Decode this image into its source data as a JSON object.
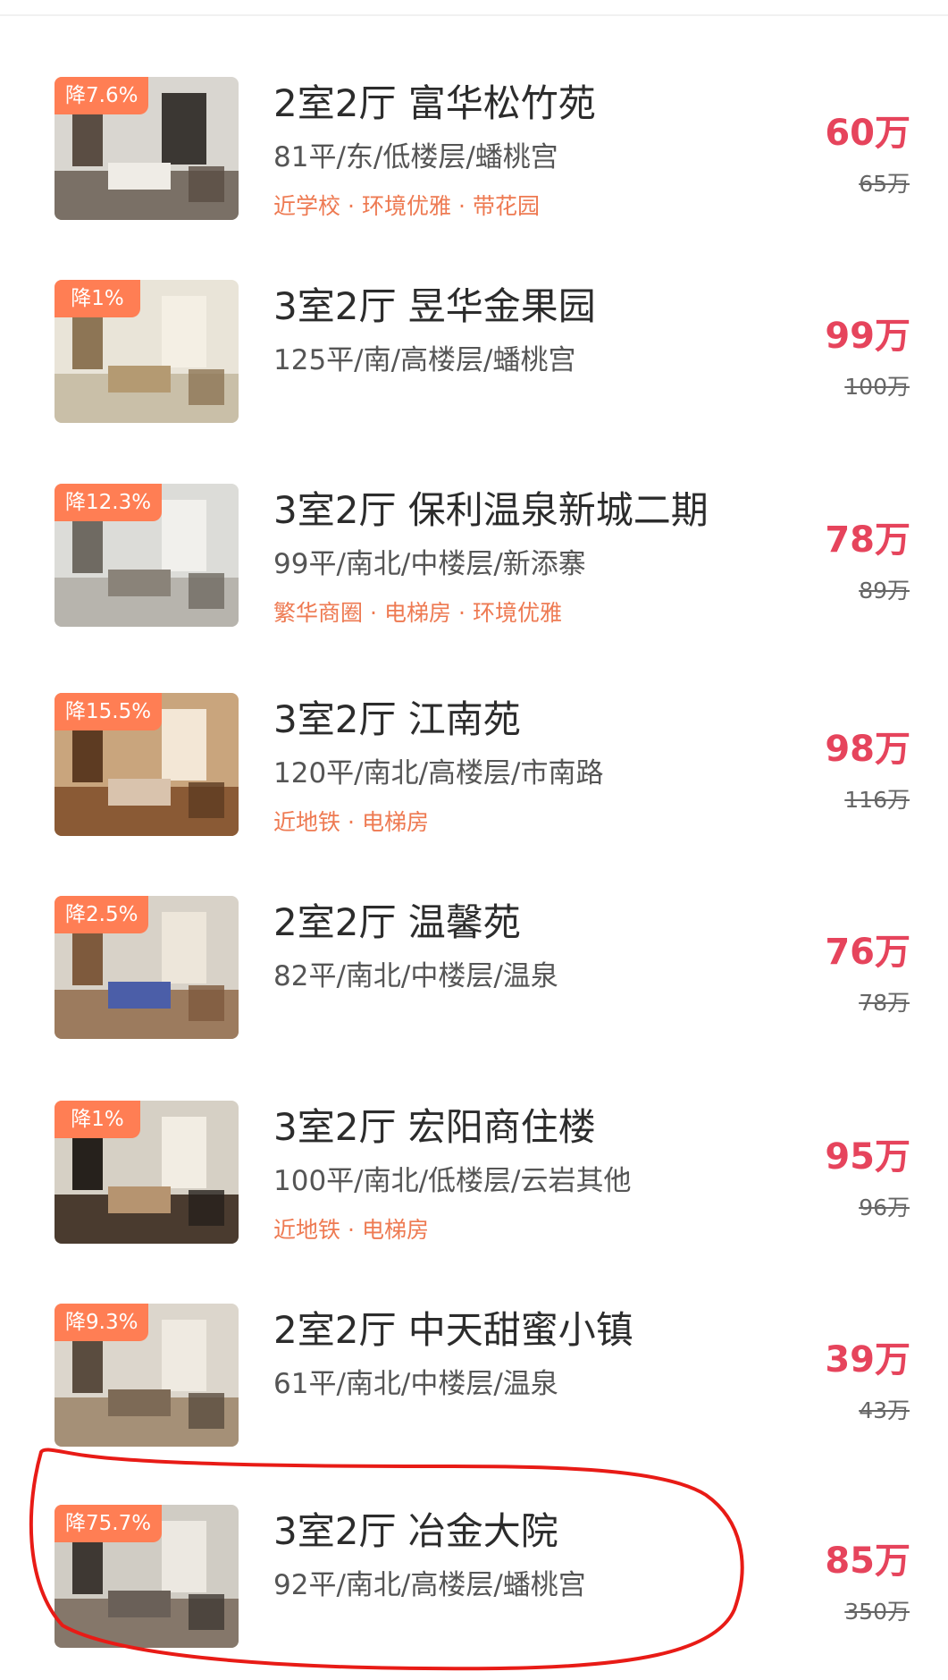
{
  "colors": {
    "badge_bg": "#ff7e54",
    "price": "#e6445c",
    "tag": "#ee7a52",
    "annotation_ring": "#e81b16"
  },
  "listings": [
    {
      "discount": "降7.6%",
      "title": "2室2厅 富华松竹苑",
      "meta": "81平/东/低楼层/蟠桃宫",
      "tags": [
        "近学校",
        "环境优雅",
        "带花园"
      ],
      "price": "60万",
      "old_price": "65万"
    },
    {
      "discount": "降1%",
      "title": "3室2厅 昱华金果园",
      "meta": "125平/南/高楼层/蟠桃宫",
      "tags": [],
      "price": "99万",
      "old_price": "100万"
    },
    {
      "discount": "降12.3%",
      "title": "3室2厅 保利温泉新城二期",
      "meta": "99平/南北/中楼层/新添寨",
      "tags": [
        "繁华商圈",
        "电梯房",
        "环境优雅"
      ],
      "price": "78万",
      "old_price": "89万"
    },
    {
      "discount": "降15.5%",
      "title": "3室2厅 江南苑",
      "meta": "120平/南北/高楼层/市南路",
      "tags": [
        "近地铁",
        "电梯房"
      ],
      "price": "98万",
      "old_price": "116万"
    },
    {
      "discount": "降2.5%",
      "title": "2室2厅 温馨苑",
      "meta": "82平/南北/中楼层/温泉",
      "tags": [],
      "price": "76万",
      "old_price": "78万"
    },
    {
      "discount": "降1%",
      "title": "3室2厅 宏阳商住楼",
      "meta": "100平/南北/低楼层/云岩其他",
      "tags": [
        "近地铁",
        "电梯房"
      ],
      "price": "95万",
      "old_price": "96万"
    },
    {
      "discount": "降9.3%",
      "title": "2室2厅 中天甜蜜小镇",
      "meta": "61平/南北/中楼层/温泉",
      "tags": [],
      "price": "39万",
      "old_price": "43万"
    },
    {
      "discount": "降75.7%",
      "title": "3室2厅 冶金大院",
      "meta": "92平/南北/高楼层/蟠桃宫",
      "tags": [],
      "price": "85万",
      "old_price": "350万"
    }
  ]
}
